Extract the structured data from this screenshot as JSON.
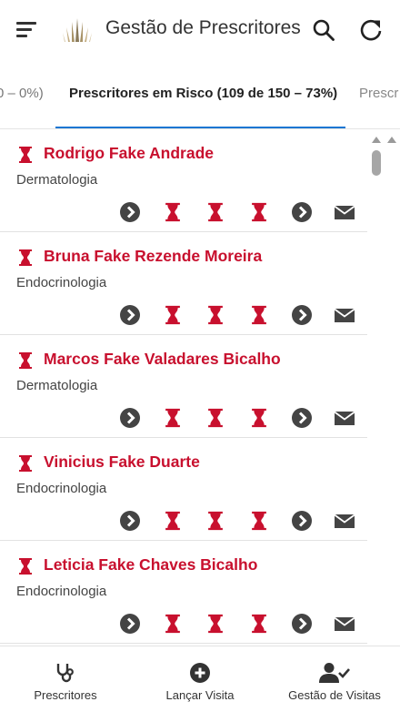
{
  "header": {
    "title": "Gestão de Prescritores",
    "menu_icon": "hamburger-menu-icon",
    "logo_icon": "brand-logo-icon",
    "search_icon": "search-icon",
    "refresh_icon": "refresh-icon"
  },
  "tabs": [
    {
      "label": "0 – 0%)"
    },
    {
      "label": "Prescritores em Risco (109 de 150 – 73%)"
    },
    {
      "label": "Prescr"
    }
  ],
  "colors": {
    "accent": "#1976d2",
    "risk": "#c8102e",
    "icon_dark": "#444444"
  },
  "prescribers": [
    {
      "name": "Rodrigo Fake Andrade",
      "specialty": "Dermatologia"
    },
    {
      "name": "Bruna Fake Rezende Moreira",
      "specialty": "Endocrinologia"
    },
    {
      "name": "Marcos Fake Valadares Bicalho",
      "specialty": "Dermatologia"
    },
    {
      "name": "Vinicius Fake Duarte",
      "specialty": "Endocrinologia"
    },
    {
      "name": "Leticia Fake Chaves Bicalho",
      "specialty": "Endocrinologia"
    }
  ],
  "card_action_icons": [
    "chevron-right-circle-icon",
    "hourglass-icon",
    "hourglass-icon",
    "hourglass-icon",
    "chevron-right-circle-icon",
    "envelope-icon"
  ],
  "bottom_nav": [
    {
      "label": "Prescritores",
      "icon": "stethoscope-icon"
    },
    {
      "label": "Lançar Visita",
      "icon": "add-circle-icon"
    },
    {
      "label": "Gestão de Visitas",
      "icon": "user-check-icon"
    }
  ]
}
